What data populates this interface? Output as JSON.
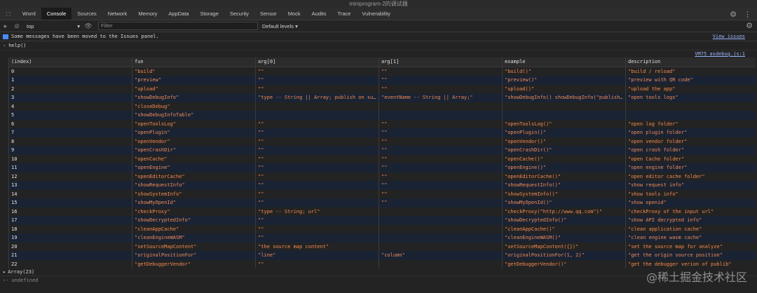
{
  "window": {
    "title": "miniprogram-2的调试器"
  },
  "tabs": [
    {
      "label": "Wxml",
      "active": false
    },
    {
      "label": "Console",
      "active": true
    },
    {
      "label": "Sources",
      "active": false
    },
    {
      "label": "Network",
      "active": false
    },
    {
      "label": "Memory",
      "active": false
    },
    {
      "label": "AppData",
      "active": false
    },
    {
      "label": "Storage",
      "active": false
    },
    {
      "label": "Security",
      "active": false
    },
    {
      "label": "Sensor",
      "active": false
    },
    {
      "label": "Mock",
      "active": false
    },
    {
      "label": "Audits",
      "active": false
    },
    {
      "label": "Trace",
      "active": false
    },
    {
      "label": "Vulnerability",
      "active": false
    }
  ],
  "toolbar": {
    "context": "top",
    "filter_placeholder": "Filter",
    "levels": "Default levels ▾"
  },
  "console": {
    "issues_message": "Some messages have been moved to the Issues panel.",
    "view_issues": "View issues",
    "command": "help()",
    "source_link": "VM75 asdebug.js:1",
    "array_summary": "Array(23)",
    "result": "undefined"
  },
  "table": {
    "headers": [
      "(index)",
      "fun",
      "arg[0]",
      "arg[1]",
      "example",
      "description"
    ],
    "rows": [
      [
        "0",
        "\"build\"",
        "\"\"",
        "\"\"",
        "\"build()\"",
        "\"build / reload\""
      ],
      [
        "1",
        "\"preview\"",
        "\"\"",
        "\"\"",
        "\"preview()\"",
        "\"preview with QR code\""
      ],
      [
        "2",
        "\"upload\"",
        "\"\"",
        "\"\"",
        "\"upload()\"",
        "\"upload the app\""
      ],
      [
        "3",
        "\"showDebugInfo\"",
        "\"type -- String || Array; publish on sub…",
        "\"eventName -- String || Array;\"",
        "\"showDebugInfo() showDebugInfo(\"publish\"…",
        "\"open tools logs\""
      ],
      [
        "4",
        "\"closeDebug\"",
        "",
        "",
        "",
        ""
      ],
      [
        "5",
        "\"showDebugInfoTable\"",
        "",
        "",
        "",
        ""
      ],
      [
        "6",
        "\"openToolsLog\"",
        "\"\"",
        "\"\"",
        "\"openToolsLog()\"",
        "\"open log folder\""
      ],
      [
        "7",
        "\"openPlugin\"",
        "\"\"",
        "\"\"",
        "\"openPlugin()\"",
        "\"open plugin folder\""
      ],
      [
        "8",
        "\"openVendor\"",
        "\"\"",
        "\"\"",
        "\"openVendor()\"",
        "\"open vendor folder\""
      ],
      [
        "9",
        "\"openCrashDir\"",
        "\"\"",
        "\"\"",
        "\"openCrashDir()\"",
        "\"open crash folder\""
      ],
      [
        "10",
        "\"openCache\"",
        "\"\"",
        "\"\"",
        "\"openCache()\"",
        "\"open Cache folder\""
      ],
      [
        "11",
        "\"openEngine\"",
        "\"\"",
        "\"\"",
        "\"openEngine()\"",
        "\"open engine folder\""
      ],
      [
        "12",
        "\"openEditorCache\"",
        "\"\"",
        "\"\"",
        "\"openEditorCache()\"",
        "\"open editor cache folder\""
      ],
      [
        "13",
        "\"showRequestInfo\"",
        "\"\"",
        "\"\"",
        "\"showRequestInfo()\"",
        "\"show request info\""
      ],
      [
        "14",
        "\"showSystemInfo\"",
        "\"\"",
        "\"\"",
        "\"showSystemInfo()\"",
        "\"show tools info\""
      ],
      [
        "15",
        "\"showMyOpenId\"",
        "\"\"",
        "\"\"",
        "\"showMyOpenId()\"",
        "\"show openid\""
      ],
      [
        "16",
        "\"checkProxy\"",
        "\"type -- String; url\"",
        "",
        "\"checkProxy(\"http://www.qq.com\")\"",
        "\"checkProxy of the input url\""
      ],
      [
        "17",
        "\"showDecryptedInfo\"",
        "\"\"",
        "",
        "\"showDecryptedInfo()\"",
        "\"show API decrypted info\""
      ],
      [
        "18",
        "\"cleanAppCache\"",
        "\"\"",
        "",
        "\"cleanAppCache()\"",
        "\"clean application cache\""
      ],
      [
        "19",
        "\"cleanEngineWASM\"",
        "\"\"",
        "",
        "\"cleanEngineWASM()\"",
        "\"clean engine wasm cache\""
      ],
      [
        "20",
        "\"setSourceMapContent\"",
        "\"the source map content\"",
        "",
        "\"setSourceMapContent({})\"",
        "\"set the source map for analyze\""
      ],
      [
        "21",
        "\"originalPositionFor\"",
        "\"line\"",
        "\"column\"",
        "\"originalPositionFor(1, 2)\"",
        "\"get the origin source position\""
      ],
      [
        "22",
        "\"getDebuggerVendor\"",
        "\"\"",
        "",
        "\"getDebuggerVendor()\"",
        "\"get the debugger verion of publib\""
      ]
    ]
  },
  "watermark": "@稀土掘金技术社区"
}
